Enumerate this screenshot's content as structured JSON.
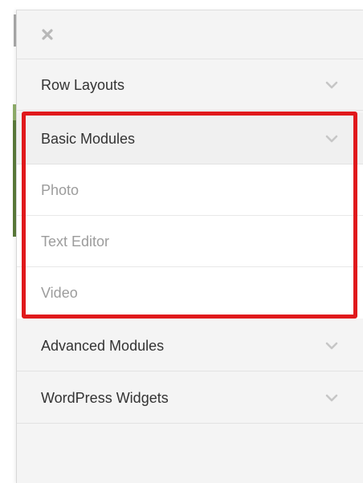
{
  "panel": {
    "close_icon": "close-icon",
    "sections": [
      {
        "label": "Row Layouts",
        "icon": "chevron-down-icon"
      },
      {
        "label": "Basic Modules",
        "icon": "chevron-down-icon",
        "items": [
          "Photo",
          "Text Editor",
          "Video"
        ]
      },
      {
        "label": "Advanced Modules",
        "icon": "chevron-down-icon"
      },
      {
        "label": "WordPress Widgets",
        "icon": "chevron-down-icon"
      }
    ]
  },
  "colors": {
    "highlight": "#e0191c",
    "panel_bg": "#f4f4f4",
    "sub_text": "#9c9c9c",
    "label_text": "#333333"
  }
}
